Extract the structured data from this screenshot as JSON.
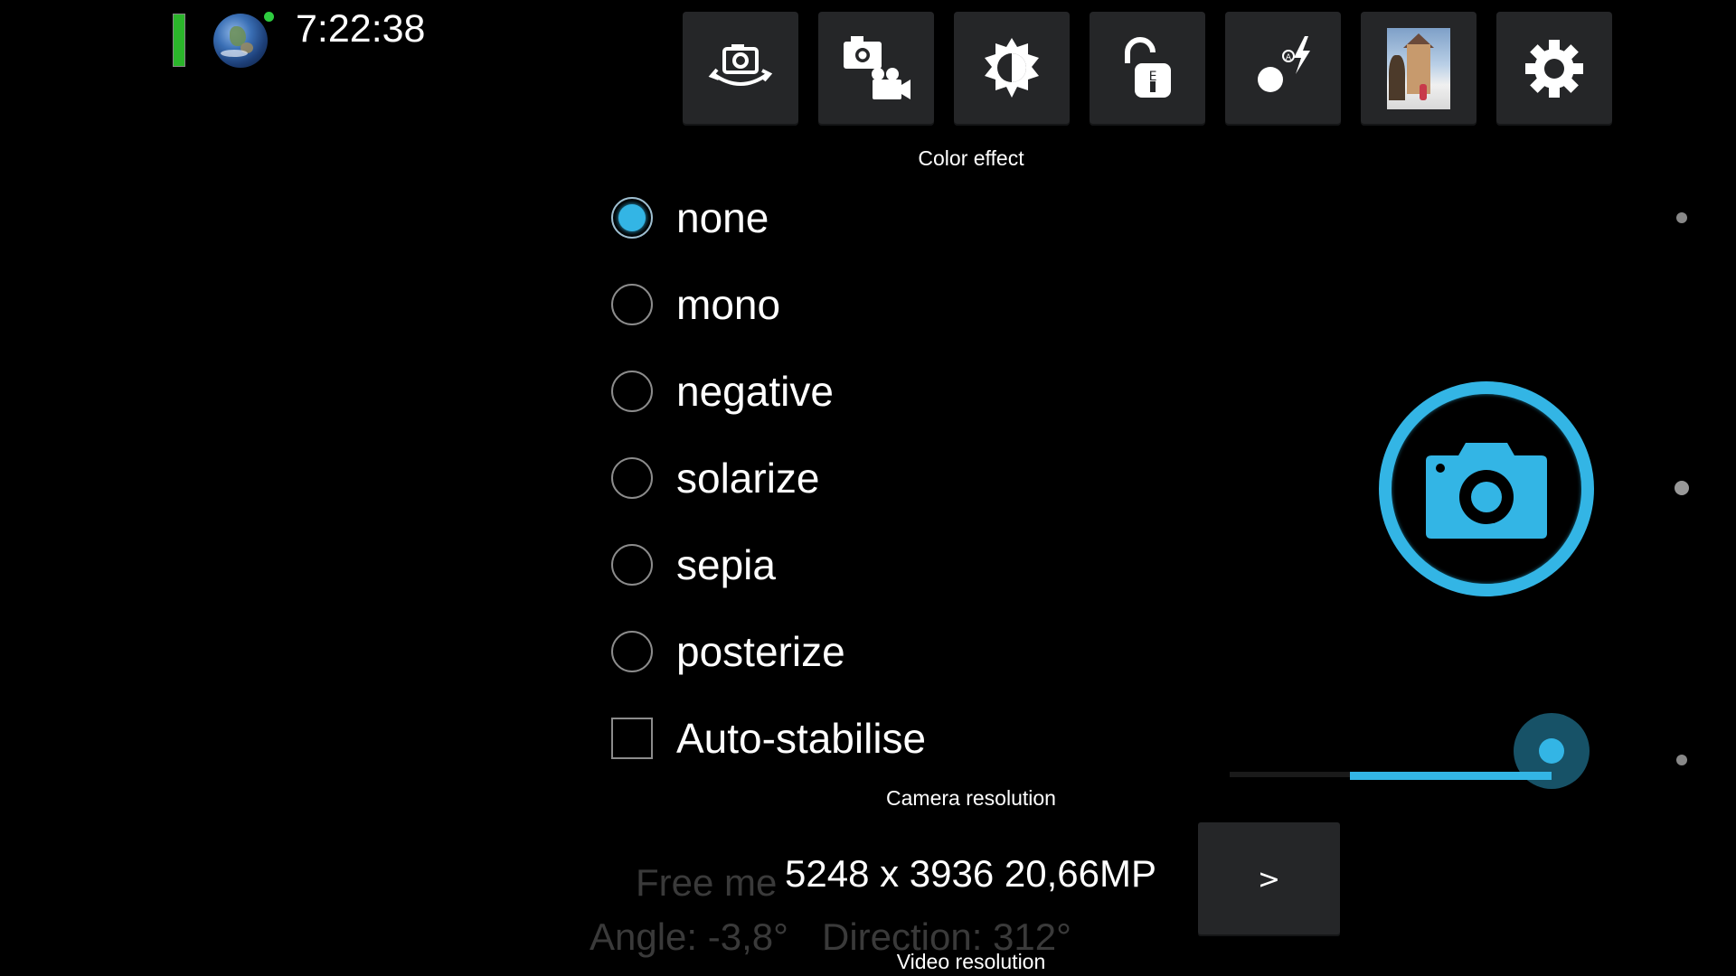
{
  "status": {
    "time": "7:22:38",
    "battery_color": "#2bb52b",
    "gps_dot_color": "#2ecc40"
  },
  "toolbar": {
    "buttons": [
      {
        "name": "switch-camera",
        "icon": "camera-rotate-icon"
      },
      {
        "name": "switch-video",
        "icon": "photo-video-icon"
      },
      {
        "name": "exposure",
        "icon": "exposure-sun-icon"
      },
      {
        "name": "exposure-lock",
        "icon": "exposure-lock-icon"
      },
      {
        "name": "flash-auto",
        "icon": "flash-auto-icon"
      },
      {
        "name": "gallery",
        "icon": "gallery-thumbnail"
      },
      {
        "name": "settings",
        "icon": "gear-icon"
      }
    ]
  },
  "color_effect": {
    "title": "Color effect",
    "selected": "none",
    "options": [
      "none",
      "mono",
      "negative",
      "solarize",
      "sepia",
      "posterize"
    ]
  },
  "auto_stabilise": {
    "label": "Auto-stabilise",
    "checked": false
  },
  "camera_resolution": {
    "title": "Camera resolution",
    "value": "5248 x 3936 20,66MP",
    "next_label": ">"
  },
  "video_resolution": {
    "title": "Video resolution"
  },
  "overlay": {
    "memory_text": "Free me",
    "angle_text": "Angle: -3,8°",
    "direction_text": "Direction: 312°"
  },
  "zoom": {
    "level_fraction": 1.0
  },
  "colors": {
    "accent": "#33b5e5",
    "button_bg": "#252628"
  }
}
